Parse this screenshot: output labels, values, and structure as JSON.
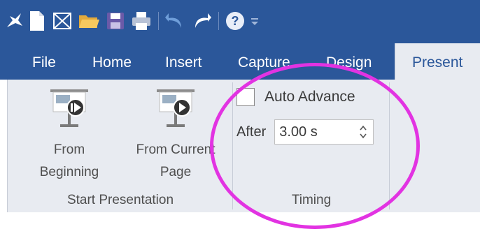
{
  "quick_access_toolbar": {
    "icons": [
      "app-logo-icon",
      "new-document-icon",
      "template-icon",
      "open-folder-icon",
      "save-icon",
      "print-icon",
      "undo-icon",
      "redo-icon",
      "help-icon",
      "customize-toolbar-icon"
    ],
    "help_label": "?"
  },
  "ribbon_tabs": [
    {
      "label": "File",
      "active": false
    },
    {
      "label": "Home",
      "active": false
    },
    {
      "label": "Insert",
      "active": false
    },
    {
      "label": "Capture",
      "active": false
    },
    {
      "label": "Design",
      "active": false
    },
    {
      "label": "Present",
      "active": true
    }
  ],
  "start_presentation": {
    "group_label": "Start Presentation",
    "from_beginning": {
      "line1": "From",
      "line2": "Beginning",
      "icon": "presentation-screen-play-icon"
    },
    "from_current_page": {
      "line1": "From Current",
      "line2": "Page",
      "icon": "presentation-screen-play-icon"
    }
  },
  "timing": {
    "group_label": "Timing",
    "auto_advance_label": "Auto Advance",
    "auto_advance_checked": false,
    "after_label": "After",
    "after_value": "3.00 s"
  },
  "colors": {
    "title_bar": "#2b579a",
    "ribbon_background": "#e8ebf1",
    "annotation_circle": "#e233e2"
  }
}
